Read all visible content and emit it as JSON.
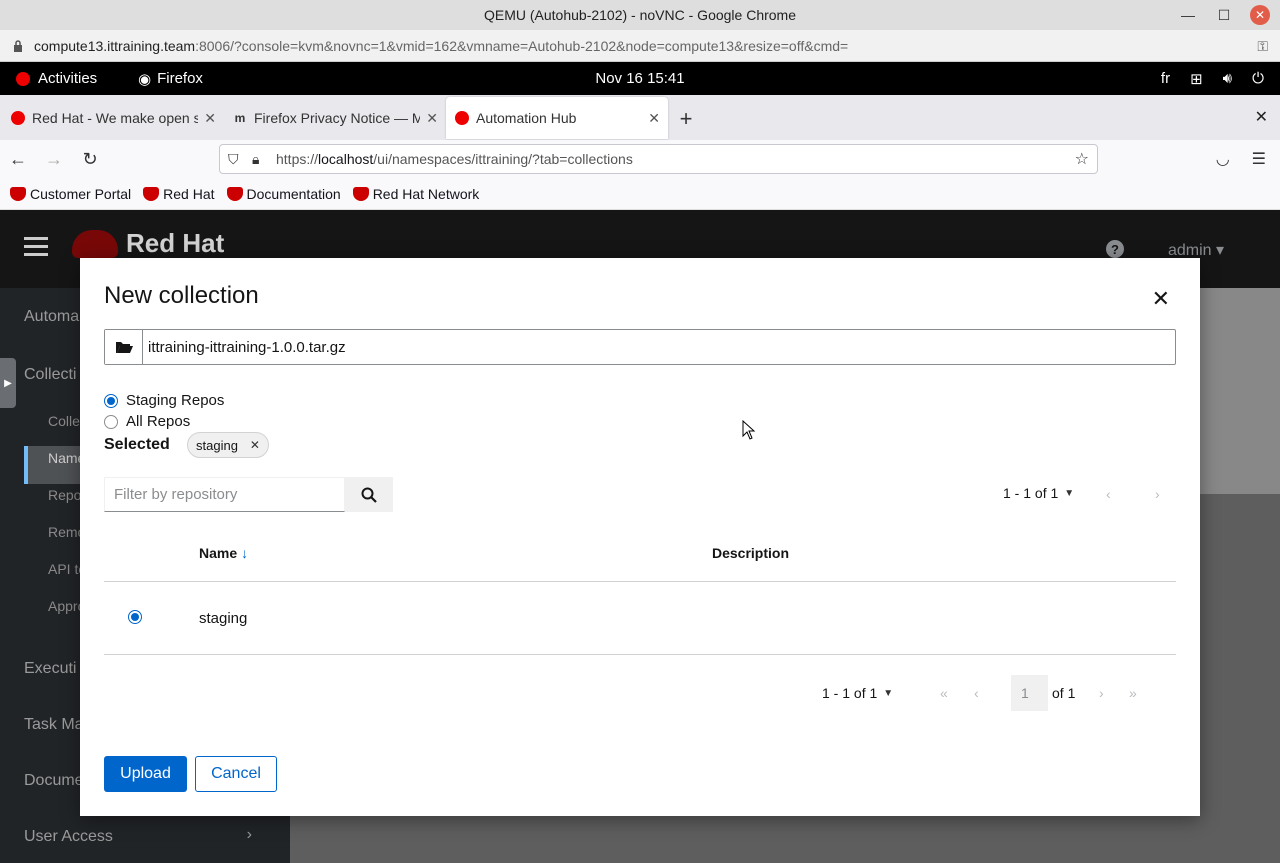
{
  "chrome": {
    "title": "QEMU (Autohub-2102) - noVNC - Google Chrome",
    "url_host": "compute13.ittraining.team",
    "url_rest": ":8006/?console=kvm&novnc=1&vmid=162&vmname=Autohub-2102&node=compute13&resize=off&cmd="
  },
  "gnome": {
    "activities": "Activities",
    "app": "Firefox",
    "clock": "Nov 16  15:41",
    "lang": "fr"
  },
  "firefox": {
    "tabs": [
      {
        "title": "Red Hat - We make open source",
        "active": false
      },
      {
        "title": "Firefox Privacy Notice — Mozilla",
        "active": false
      },
      {
        "title": "Automation Hub",
        "active": true
      }
    ],
    "url_prefix": "https://",
    "url_host": "localhost",
    "url_path": "/ui/namespaces/ittraining/?tab=collections",
    "bookmarks": [
      "Customer Portal",
      "Red Hat",
      "Documentation",
      "Red Hat Network"
    ]
  },
  "app": {
    "logo_text": "Red Hat",
    "user": "admin",
    "sidebar": {
      "items": [
        "Automa",
        "Collecti",
        "Executi",
        "Task Ma",
        "Docume",
        "User Access"
      ],
      "subitems": [
        "Colle",
        "Name",
        "Repo",
        "Remo",
        "API to",
        "Appro"
      ]
    }
  },
  "modal": {
    "title": "New collection",
    "file_name": "ittraining-ittraining-1.0.0.tar.gz",
    "radio_staging": "Staging Repos",
    "radio_all": "All Repos",
    "selected_label": "Selected",
    "chip": "staging",
    "filter_placeholder": "Filter by repository",
    "pager_top": "1 - 1 of 1",
    "col_name": "Name",
    "col_description": "Description",
    "rows": [
      {
        "name": "staging",
        "selected": true
      }
    ],
    "pager_bottom": "1 - 1 of 1",
    "page_value": "1",
    "of_pages": "of 1",
    "upload": "Upload",
    "cancel": "Cancel"
  },
  "colors": {
    "primary": "#0066cc",
    "modal_bg": "#ffffff",
    "header_bg": "#151515",
    "sidebar_bg": "#212427"
  }
}
